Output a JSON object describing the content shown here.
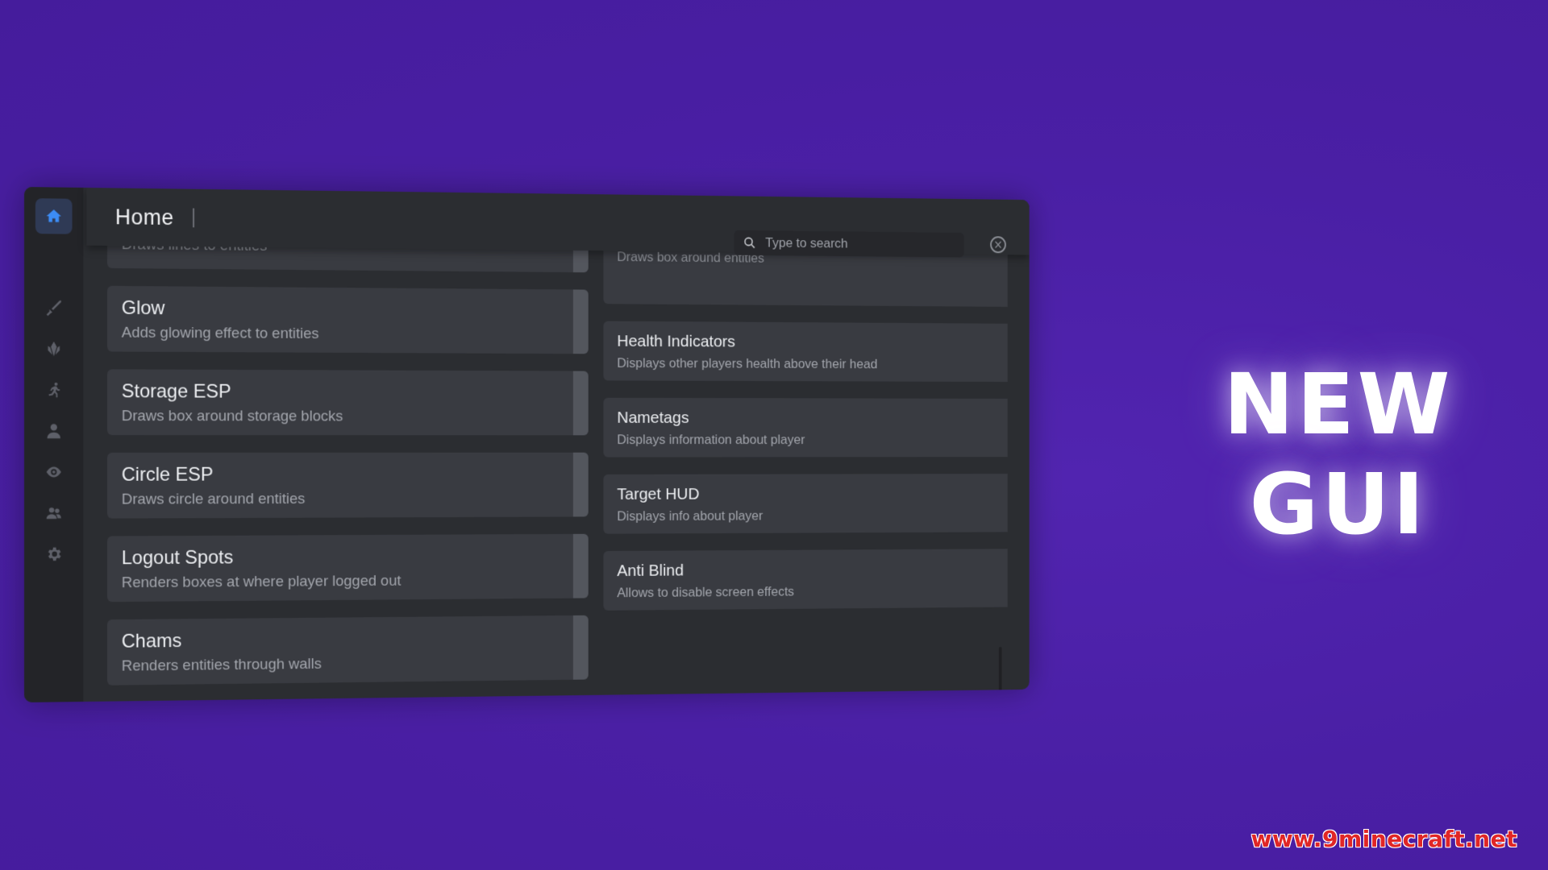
{
  "header": {
    "title": "Home",
    "search_placeholder": "Type to search"
  },
  "sidebar": {
    "items": [
      {
        "icon": "home-icon",
        "active": true
      },
      {
        "icon": "sword-icon",
        "active": false
      },
      {
        "icon": "crystal-icon",
        "active": false
      },
      {
        "icon": "running-icon",
        "active": false
      },
      {
        "icon": "user-icon",
        "active": false
      },
      {
        "icon": "eye-icon",
        "active": false
      },
      {
        "icon": "users-icon",
        "active": false
      },
      {
        "icon": "gear-icon",
        "active": false
      }
    ]
  },
  "modules": {
    "left": [
      {
        "name": "",
        "desc": "Draws lines to entities"
      },
      {
        "name": "Glow",
        "desc": "Adds glowing effect to entities"
      },
      {
        "name": "Storage ESP",
        "desc": "Draws box around storage blocks"
      },
      {
        "name": "Circle ESP",
        "desc": "Draws circle around entities"
      },
      {
        "name": "Logout Spots",
        "desc": "Renders boxes at where player logged out"
      },
      {
        "name": "Chams",
        "desc": "Renders entities through walls"
      }
    ],
    "right": [
      {
        "name": "",
        "desc": "Draws box around entities"
      },
      {
        "name": "Health Indicators",
        "desc": "Displays other players health above their head"
      },
      {
        "name": "Nametags",
        "desc": "Displays information about player"
      },
      {
        "name": "Target HUD",
        "desc": "Displays info about player"
      },
      {
        "name": "Anti Blind",
        "desc": "Allows to disable screen effects"
      }
    ]
  },
  "promo": {
    "line1": "NEW",
    "line2": "GUI"
  },
  "watermark": "www.9minecraft.net",
  "colors": {
    "background": "#4a1fa5",
    "panel": "#2b2d31",
    "card": "#393b41",
    "accent": "#3c8cf5"
  }
}
